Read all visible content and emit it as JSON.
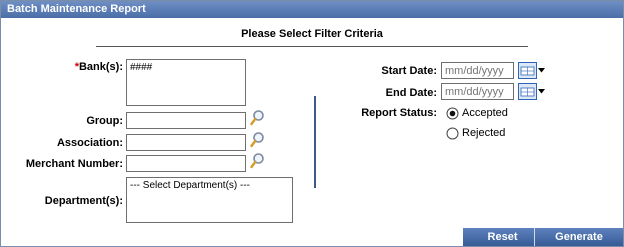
{
  "titlebar": {
    "title": "Batch Maintenance Report"
  },
  "form": {
    "heading": "Please Select Filter Criteria",
    "banks": {
      "required_mark": "*",
      "label": "Bank(s):",
      "value": "####"
    },
    "group": {
      "label": "Group:",
      "value": ""
    },
    "association": {
      "label": "Association:",
      "value": ""
    },
    "merchant_number": {
      "label": "Merchant Number:",
      "value": ""
    },
    "department": {
      "label": "Department(s):",
      "option": "--- Select Department(s) ---"
    },
    "start_date": {
      "label": "Start Date:",
      "placeholder": "mm/dd/yyyy"
    },
    "end_date": {
      "label": "End Date:",
      "placeholder": "mm/dd/yyyy"
    },
    "report_status": {
      "label": "Report Status:",
      "options": [
        {
          "label": "Accepted",
          "selected": true
        },
        {
          "label": "Rejected",
          "selected": false
        }
      ]
    }
  },
  "buttons": {
    "reset": "Reset",
    "generate": "Generate"
  },
  "colors": {
    "titlebar": "#4a6ea8",
    "buttons": "#365a96",
    "required": "#cc0000",
    "divider": "#3b5a8c"
  }
}
